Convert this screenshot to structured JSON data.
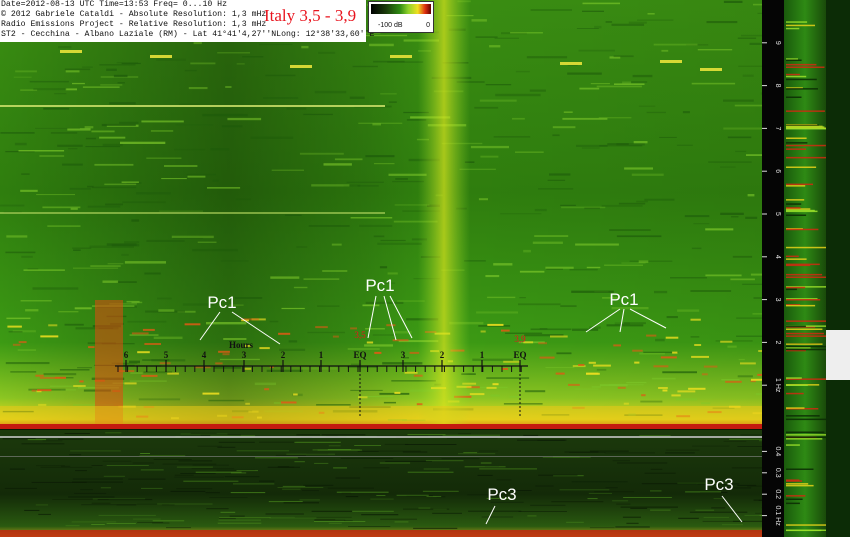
{
  "header": {
    "line1": "Date=2012-08-13 UTC Time=13:53 Freq= 0...10 Hz",
    "line2": "© 2012 Gabriele Cataldi - Absolute Resolution: 1,3 mHz",
    "line3": "Radio Emissions Project - Relative Resolution: 1,3 mHz",
    "line4_left": "ST2 - Cecchina - Albano Laziale (RM) - Lat 41°41'4,27''N",
    "line4_right": "Long: 12°38'33,60''E",
    "title": "Italy 3,5 - 3,9"
  },
  "colorbar": {
    "min_label": "-100 dB",
    "max_label": "0"
  },
  "colors": {
    "title": "#e8141e",
    "annotation_text": "#ffffff",
    "marker_red": "#e8141e",
    "axis_text": "#e0e0e0"
  },
  "chart_data": {
    "type": "heatmap",
    "title": "Italy 3,5 - 3,9",
    "upper_panel": {
      "yaxis_ticks": [
        "1 Hz",
        "2",
        "3",
        "4",
        "5",
        "6",
        "7",
        "8",
        "9"
      ],
      "ylim": [
        0,
        10
      ],
      "yunit": "Hz"
    },
    "lower_panel": {
      "yaxis_ticks": [
        "0.1 Hz",
        "0.2",
        "0.3",
        "0.4"
      ],
      "ylim": [
        0,
        0.5
      ],
      "yunit": "Hz"
    },
    "hours_label": "Hours",
    "hours_ticks_left": [
      "6",
      "5",
      "4",
      "3",
      "2",
      "1",
      "EQ"
    ],
    "hours_ticks_right": [
      "3",
      "2",
      "1",
      "EQ"
    ],
    "eq_markers": [
      "3,5",
      "3,9"
    ],
    "annotations": [
      "Pc1",
      "Pc1",
      "Pc1",
      "Pc3",
      "Pc3"
    ]
  }
}
